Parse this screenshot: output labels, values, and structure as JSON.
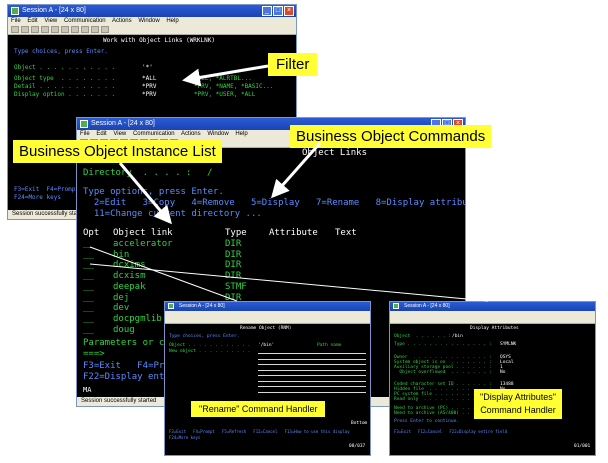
{
  "window1": {
    "title": "Session A - [24 x 80]",
    "menu": [
      "File",
      "Edit",
      "View",
      "Communication",
      "Actions",
      "Window",
      "Help"
    ],
    "screen_title": "Work with Object Links (WRKLNK)",
    "prompt": "Type choices, press Enter.",
    "rows": [
      {
        "label": "Object . . . . . . . . . . .",
        "value": "'*'"
      },
      {
        "label": "Object type  . . . . . . . .",
        "value": "*ALL",
        "hint": "*ALL, *ALRTBL..."
      },
      {
        "label": "Detail . . . . . . . . . . .",
        "value": "*PRV",
        "hint": "*PRV, *NAME, *BASIC..."
      },
      {
        "label": "Display option . . . . . . .",
        "value": "*PRV",
        "hint": "*PRV, *USER, *ALL"
      }
    ],
    "fkeys1": "F3=Exit  F4=Prompt",
    "fkeys2": "F24=More keys",
    "status": "Session successfully started"
  },
  "window2": {
    "title": "Session A - [24 x 80]",
    "menu": [
      "File",
      "Edit",
      "View",
      "Communication",
      "Actions",
      "Window",
      "Help"
    ],
    "screen_title": "Object Links",
    "directory_label": "Directory  . . . . :",
    "directory_value": "/",
    "prompt": "Type options, press Enter.",
    "options_line1": "  2=Edit   3=Copy   4=Remove   5=Display   7=Rename   8=Display attributes",
    "options_line2": "  11=Change current directory ...",
    "col_opt": "Opt",
    "col_link": "Object link",
    "col_type": "Type",
    "col_attr": "Attribute",
    "col_text": "Text",
    "objects": [
      {
        "name": "accelerator",
        "type": "DIR"
      },
      {
        "name": "bin",
        "type": "DIR"
      },
      {
        "name": "dcxims",
        "type": "DIR"
      },
      {
        "name": "dcxism",
        "type": "DIR"
      },
      {
        "name": "deepak",
        "type": "STMF"
      },
      {
        "name": "dej",
        "type": "DIR"
      },
      {
        "name": "dev",
        "type": "DIR"
      },
      {
        "name": "docpgmlib",
        "type": "DIR"
      },
      {
        "name": "doug",
        "type": "DIR"
      }
    ],
    "params_label": "Parameters or command",
    "cmd_prompt": "===>",
    "fkeys1": "F3=Exit   F4=Prompt",
    "fkeys2": "F22=Display entire",
    "status": "Session successfully started",
    "oia_mode": "MA"
  },
  "window3": {
    "title": "Session A - [24 x 80]",
    "screen_title": "Rename Object (RNM)",
    "prompt": "Type choices, press Enter.",
    "object_label": "Object . . . . . . . . . . . .",
    "object_value": "'/bin'",
    "object_hint": "Path name",
    "newobj_label": "New object . . . . . . . . . .",
    "bottom_label": "Bottom",
    "fkeys1": "F3=Exit   F4=Prompt   F5=Refresh   F12=Cancel   F13=How to use this display",
    "fkeys2": "F24=More keys",
    "cursor_pos": "08/037"
  },
  "window4": {
    "title": "Session A - [24 x 80]",
    "screen_title": "Display Attributes",
    "object_label": "Object  . . . . . . :",
    "object_value": "/bin",
    "attrs": [
      {
        "label": "Type . . . . . . . . . . . . . . . :",
        "value": "SYMLNK"
      },
      {
        "label": "Owner  . . . . . . . . . . . . . . :",
        "value": "QSYS"
      },
      {
        "label": "System object is on  . . . . . . . :",
        "value": "Local"
      },
      {
        "label": "Auxiliary storage pool . . . . . . :",
        "value": "1"
      },
      {
        "label": "  Object overflowed  . . . . . . . :",
        "value": "No"
      },
      {
        "label": "Coded character set ID . . . . . . :",
        "value": "13488"
      },
      {
        "label": "Hidden file  . . . . . . . . . . . :",
        "value": "No"
      },
      {
        "label": "PC system file . . . . . . . . . . :",
        "value": "No"
      },
      {
        "label": "Read only  . . . . . . . . . . . . :",
        "value": "No"
      },
      {
        "label": "Need to archive (PC) . . . . . . . :",
        "value": "No"
      },
      {
        "label": "Need to archive (AS/400) . . . . . :",
        "value": "No"
      }
    ],
    "continue_prompt": "Press Enter to continue.",
    "fkeys": "F3=Exit   F12=Cancel   F22=Display entire field",
    "cursor_pos": "01/001"
  },
  "callouts": {
    "filter": "Filter",
    "commands": "Business Object Commands",
    "instance_list": "Business Object Instance List",
    "rename_handler": "\"Rename\" Command Handler",
    "display_handler_line1": "\"Display Attributes\"",
    "display_handler_line2": "Command Handler"
  },
  "colors": {
    "terminal_bg": "#000000",
    "terminal_fg": "#2fd33f",
    "terminal_blue": "#5a8cff",
    "title_bar": "#2b5bd6",
    "callout_bg": "#ffff33"
  }
}
